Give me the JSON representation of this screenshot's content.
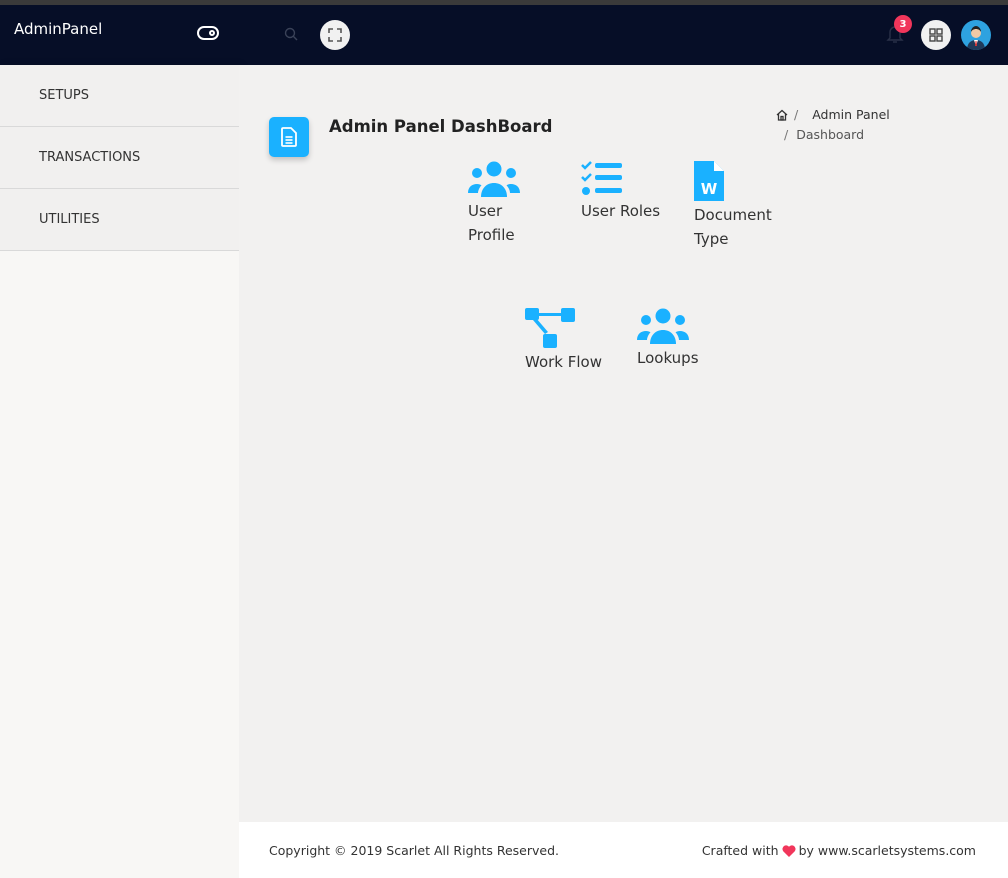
{
  "header": {
    "brand": "AdminPanel",
    "notification_count": "3",
    "icons": [
      "sidebar-toggle-icon",
      "search-icon",
      "fullscreen-icon",
      "bell-icon",
      "apps-grid-icon",
      "user-avatar"
    ]
  },
  "sidebar": {
    "items": [
      {
        "label": "SETUPS"
      },
      {
        "label": "TRANSACTIONS"
      },
      {
        "label": "UTILITIES"
      }
    ]
  },
  "page": {
    "title": "Admin Panel DashBoard",
    "title_icon": "document-icon",
    "breadcrumb": {
      "home_icon": "home-icon",
      "items": [
        "Admin Panel",
        "Dashboard"
      ]
    }
  },
  "tiles": [
    {
      "label_line1": "User",
      "label_line2": "Profile",
      "icon": "users-icon"
    },
    {
      "label_line1": "User Roles",
      "label_line2": "",
      "icon": "checklist-icon"
    },
    {
      "label_line1": "Document",
      "label_line2": "Type",
      "icon": "word-document-icon"
    },
    {
      "label_line1": "Work Flow",
      "label_line2": "",
      "icon": "workflow-icon"
    },
    {
      "label_line1": "Lookups",
      "label_line2": "",
      "icon": "users-icon"
    }
  ],
  "footer": {
    "copyright": "Copyright © 2019 Scarlet All Rights Reserved.",
    "crafted_prefix": "Crafted with",
    "crafted_suffix": "by www.scarletsystems.com"
  },
  "colors": {
    "topbar": "#060e27",
    "accent": "#1ab1ff",
    "badge": "#f1365b",
    "heart": "#f1365b"
  }
}
